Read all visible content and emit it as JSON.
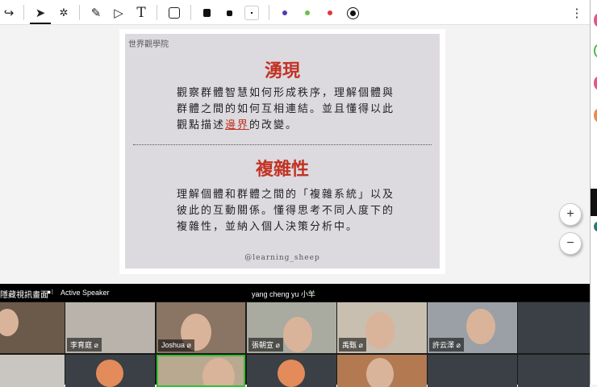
{
  "toolbar": {
    "tools": [
      "redo-icon",
      "select-icon",
      "laser-icon",
      "pen-icon",
      "highlighter-icon",
      "text-icon",
      "shape-icon"
    ],
    "sizes": [
      "large",
      "medium",
      "small"
    ],
    "colors": [
      "#4a3fb5",
      "#6ac048",
      "#e0373f",
      "#111111"
    ],
    "more": "⋮",
    "text_glyph": "T"
  },
  "slide": {
    "brand": "世界觀學院",
    "heading1": "湧現",
    "para1_a": "觀察群體智慧如何形成秩序，理解個體與群體之間的如何互相連結。並且懂得以此觀點描述",
    "para1_hl": "邊界",
    "para1_b": "的改變。",
    "heading2": "複雜性",
    "para2": "理解個體和群體之間的「複雜系統」以及彼此的互動關係。懂得思考不同人度下的複雜性，並納入個人決策分析中。",
    "handle": "@learning_sheep"
  },
  "zoom": {
    "in": "+",
    "out": "−"
  },
  "gallery": {
    "view_label": "隱藏視訊畫面",
    "speaker_label": "Active Speaker",
    "current_speaker": "yang cheng yu 小羊",
    "row1": [
      "",
      "李育庭",
      "Joshua",
      "張朝宣",
      "禹甄",
      "許云澤",
      ""
    ]
  }
}
